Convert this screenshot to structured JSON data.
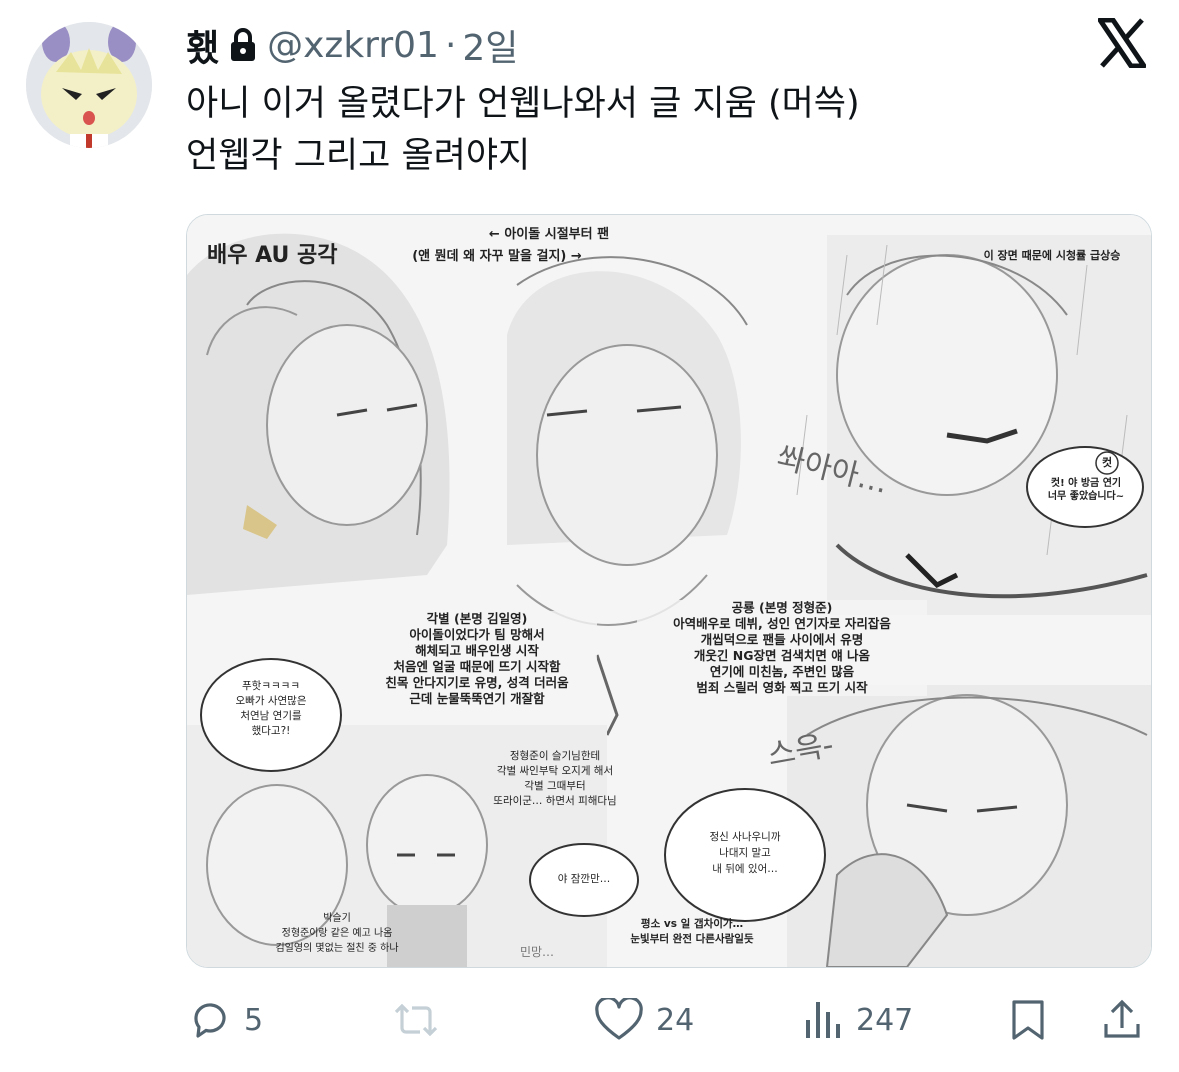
{
  "tweet": {
    "display_name": "횄",
    "handle": "@xzkrr01",
    "separator": "·",
    "time": "2일",
    "text": "아니 이거 올렸다가 언웹나와서 글 지움 (머쓱)\n언웹각 그리고 올려야지"
  },
  "media": {
    "title": "배우 AU 공각",
    "top_note_1": "← 아이돌 시절부터 팬",
    "top_note_2": "(앤 뭔데 왜 자꾸 말을 걸지) →",
    "top_right_note": "이 장면 때문에 시청률 급상승",
    "onomatopoeia_1": "쏴아아…",
    "onomatopoeia_2": "스윽-",
    "cut_bubble_mark": "컷",
    "cut_bubble": "컷! 야 방금 연기\n너무 좋았습니다~",
    "char1_desc": "각별 (본명 김일영)\n아이돌이었다가 팀 망해서\n해체되고 배우인생 시작\n처음엔 얼굴 때문에 뜨기 시작함\n친목 안다지기로 유명, 성격 더러움\n근데 눈물뚝뚝연기 개잘함",
    "char2_desc": "공룡 (본명 정형준)\n아역배우로 데뷔, 성인 연기자로 자리잡음\n개씹덕으로 팬들 사이에서 유명\n개웃긴 NG장면 검색치면 얘 나옴\n연기에 미친놈, 주변인 많음\n범죄 스릴러 영화 찍고 뜨기 시작",
    "left_bubble": "푸핫ㅋㅋㅋㅋ\n오빠가 사연많은\n처연남 연기를\n했다고?!",
    "mid_note": "정형준이 슬기님한테\n각별 싸인부탁 오지게 해서\n각별 그때부터\n또라이군… 하면서 피해다님",
    "mid_bubble": "야 잠깐만…",
    "right_bubble": "정신 사나우니까\n나대지 말고\n내 뒤에 있어…",
    "bottom_left_note": "박슬기\n정형준이랑 같은 예고 나옴\n김일영의 몇없는 절친 중 하나",
    "bottom_mid_note": "민망…",
    "bottom_right_note": "평소 vs 일 갭차이가…\n눈빛부터 완전 다른사람일듯"
  },
  "actions": {
    "reply_count": "5",
    "repost_count": "",
    "like_count": "24",
    "view_count": "247"
  },
  "icons": [
    "lock-icon",
    "x-logo-icon",
    "reply-icon",
    "repost-icon",
    "like-icon",
    "views-icon",
    "bookmark-icon",
    "share-icon"
  ]
}
